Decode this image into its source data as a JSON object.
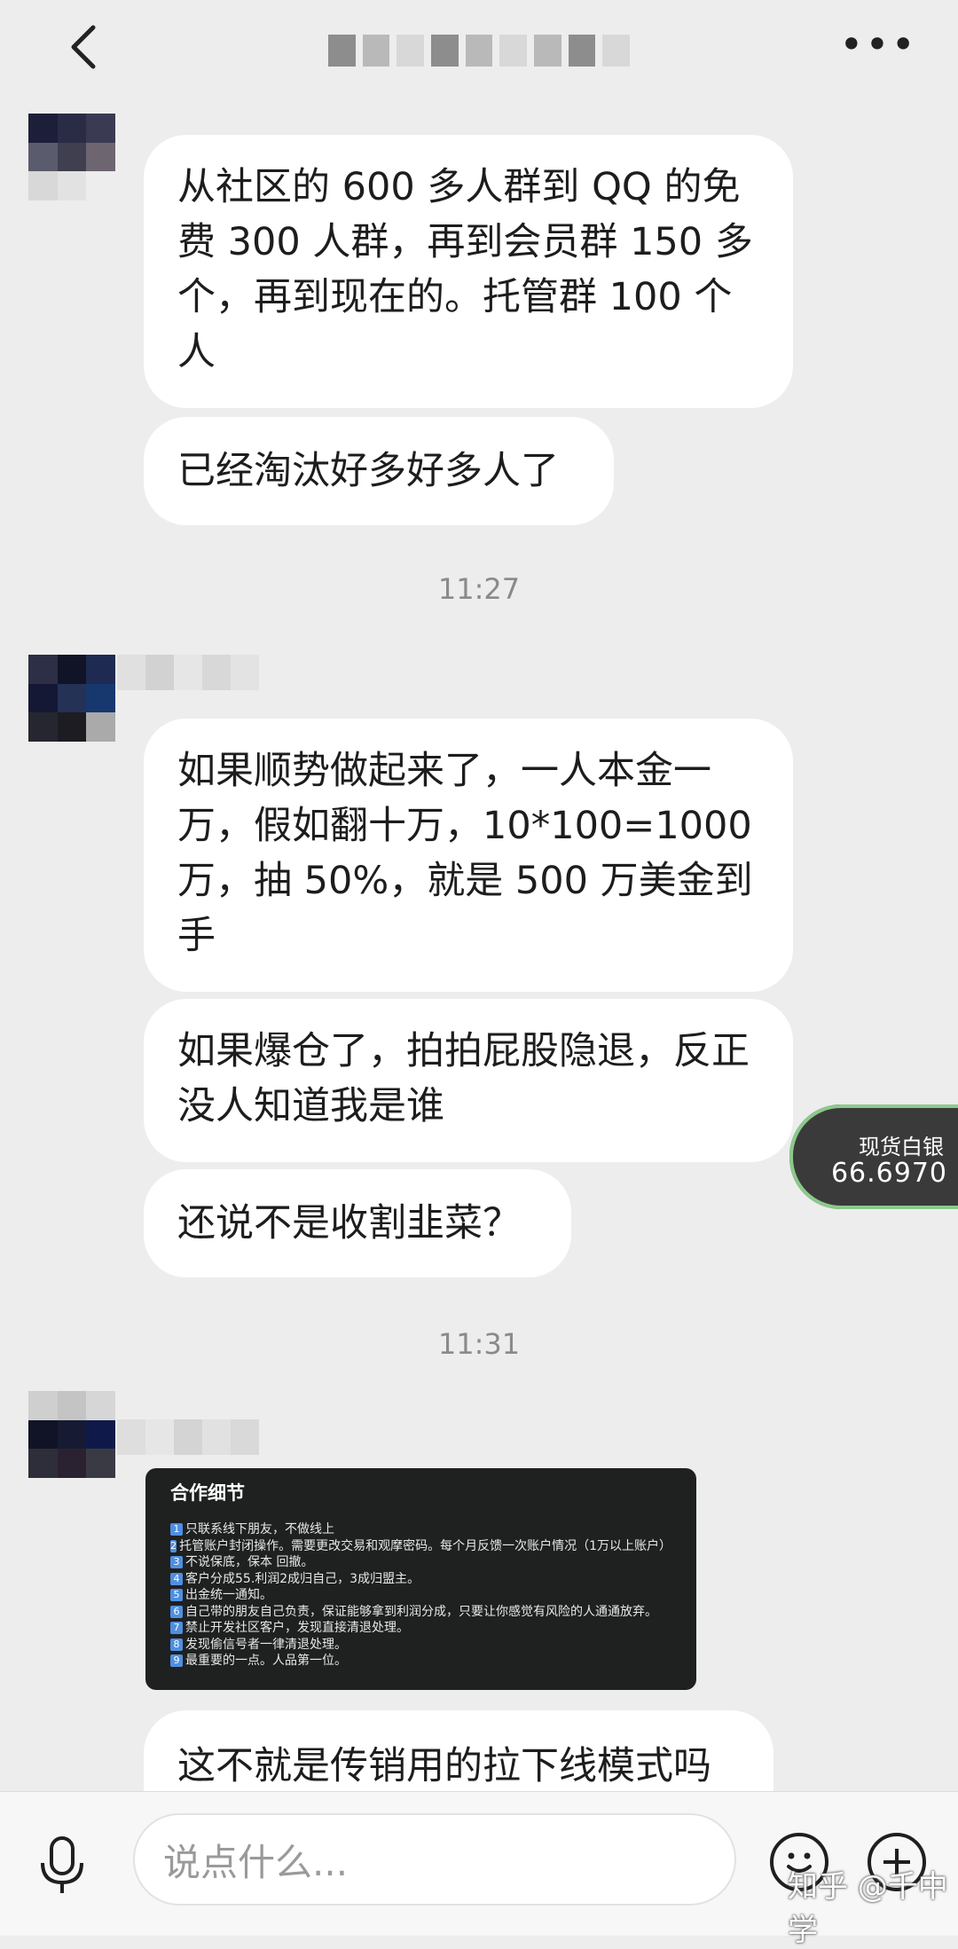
{
  "header": {
    "back_icon": "back-arrow-icon",
    "more_label": "•••"
  },
  "messages": [
    {
      "text": "从社区的 600 多人群到 QQ 的免费 300 人群，再到会员群 150 多个，再到现在的。托管群 100 个人"
    },
    {
      "text": "已经淘汰好多好多人了"
    },
    {
      "text": "如果顺势做起来了，一人本金一万，假如翻十万，10*100=1000 万，抽 50%，就是 500 万美金到手"
    },
    {
      "text": "如果爆仓了，拍拍屁股隐退，反正没人知道我是谁"
    },
    {
      "text": "还说不是收割韭菜？"
    },
    {
      "text": "这不就是传销用的拉下线模式吗"
    }
  ],
  "timestamps": [
    "11:27",
    "11:31"
  ],
  "card": {
    "title": "合作细节",
    "items": [
      {
        "n": "1",
        "text": "只联系线下朋友，不做线上"
      },
      {
        "n": "2",
        "text": "托管账户封闭操作。需要更改交易和观摩密码。每个月反馈一次账户情况（1万以上账户）"
      },
      {
        "n": "3",
        "text": "不说保底，保本 回撤。"
      },
      {
        "n": "4",
        "text": "客户分成55.利润2成归自己，3成归盟主。"
      },
      {
        "n": "5",
        "text": "出金统一通知。"
      },
      {
        "n": "6",
        "text": "自己带的朋友自己负责，保证能够拿到利润分成，只要让你感觉有风险的人通通放弃。"
      },
      {
        "n": "7",
        "text": "禁止开发社区客户，发现直接清退处理。"
      },
      {
        "n": "8",
        "text": "发现偷信号者一律清退处理。"
      },
      {
        "n": "9",
        "text": "最重要的一点。人品第一位。"
      }
    ]
  },
  "floating_widget": {
    "label": "现货白银",
    "value": "66.6970",
    "accent": "#8bc98b"
  },
  "input": {
    "placeholder": "说点什么..."
  },
  "icons": {
    "mic": "microphone-icon",
    "emoji": "emoji-icon",
    "plus": "plus-icon"
  },
  "watermark": "知乎 @千中学"
}
